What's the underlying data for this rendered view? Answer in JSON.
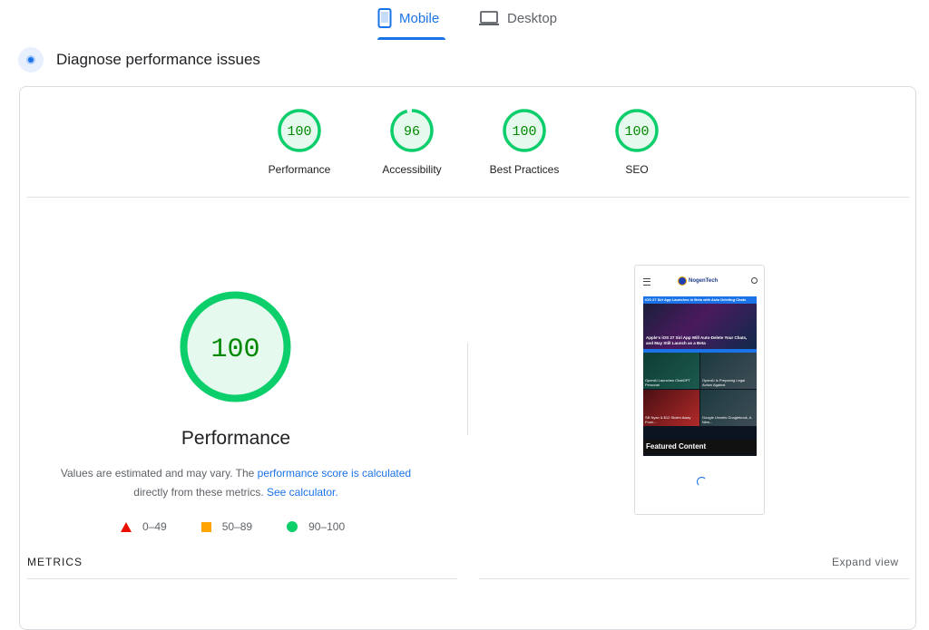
{
  "device_tabs": {
    "mobile_label": "Mobile",
    "desktop_label": "Desktop",
    "selected": "Mobile"
  },
  "section": {
    "title": "Diagnose performance issues"
  },
  "categories": [
    {
      "label": "Performance",
      "score": "100"
    },
    {
      "label": "Accessibility",
      "score": "96"
    },
    {
      "label": "Best Practices",
      "score": "100"
    },
    {
      "label": "SEO",
      "score": "100"
    }
  ],
  "main_gauge": {
    "score": "100",
    "label": "Performance"
  },
  "description": {
    "text_before": "Values are estimated and may vary. The ",
    "link_score": "performance score is calculated",
    "text_middle": "directly from these metrics.",
    "link_calculator": "See calculator."
  },
  "legend": [
    {
      "range": "0–49",
      "shape": "triangle",
      "color": "#eb0f00"
    },
    {
      "range": "50–89",
      "shape": "square",
      "color": "#ffa400"
    },
    {
      "range": "90–100",
      "shape": "circle",
      "color": "#0cce6b"
    }
  ],
  "screenshot": {
    "logo_text": "NogenTech",
    "banner": "iOS 27 Siri App Launches in Beta with Auto Deleting Chats",
    "hero_headline": "Apple's iOS 27 Siri App Will Auto-Delete Your Chats, and May Still Launch as a Beta",
    "cards": [
      "OpenAI Launches ChatGPT Personal",
      "OpenAI Is Preparing Legal Action Against",
      "SB Nyan & $12 Stolen Away From...",
      "Google Unveils Googlebook, A New..."
    ],
    "featured": "Featured Content"
  },
  "metrics": {
    "label": "METRICS",
    "expand": "Expand view"
  },
  "colors": {
    "accent": "#1a73e8",
    "pass": "#0cce6b",
    "pass_fill": "#e6f9ee",
    "pass_text": "#008800"
  }
}
